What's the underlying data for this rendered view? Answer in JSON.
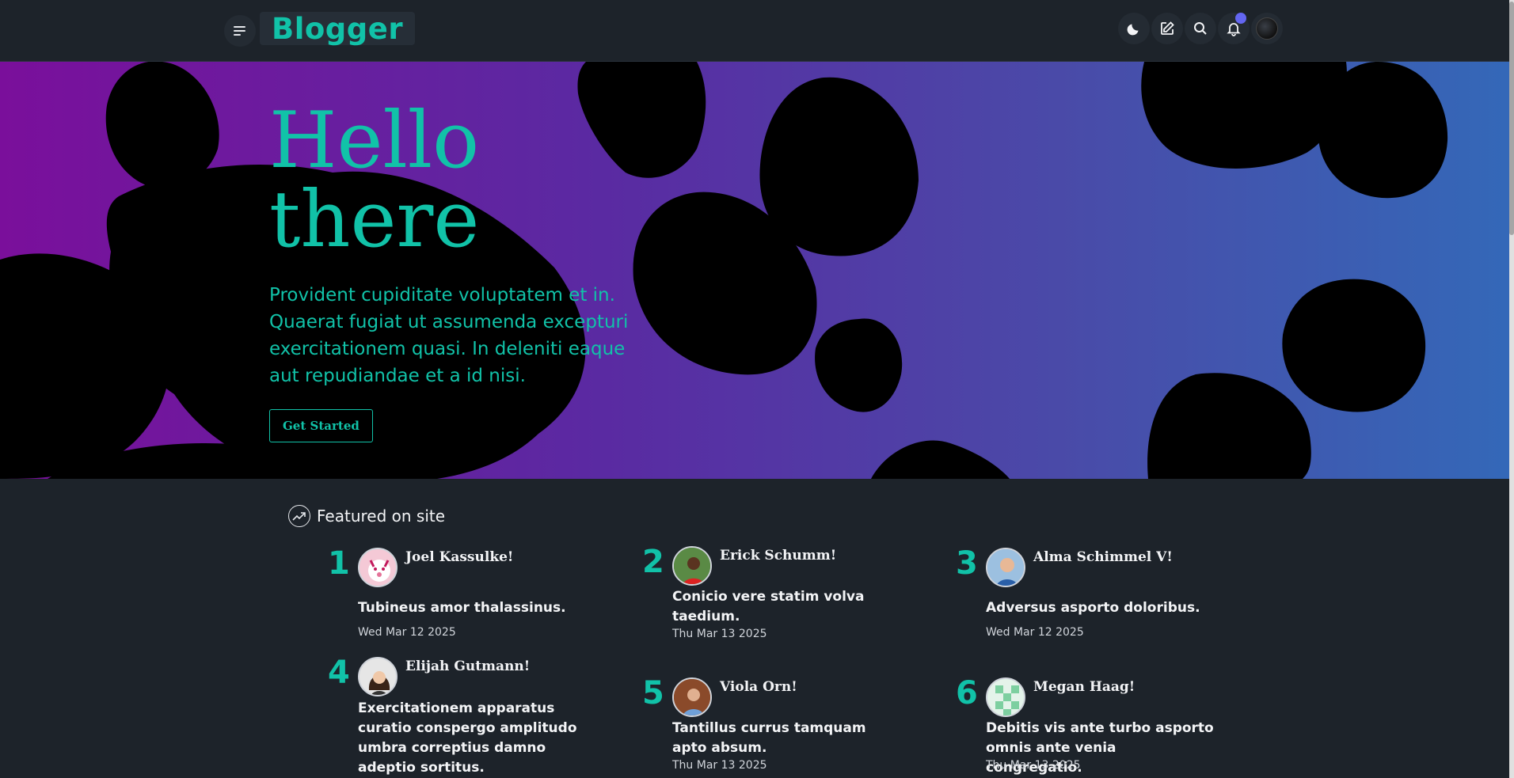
{
  "header": {
    "brand": "Blogger",
    "icons": [
      "menu-icon",
      "moon-icon",
      "edit-icon",
      "search-icon",
      "bell-icon",
      "avatar"
    ],
    "notification_color": "#6366f1"
  },
  "hero": {
    "title_line1": "Hello",
    "title_line2": "there",
    "text": "Provident cupiditate voluptatem et in. Quaerat fugiat ut assumenda excepturi exercitationem quasi. In deleniti eaque aut repudiandae et a id nisi.",
    "button": "Get Started",
    "accent": "#11c2a8"
  },
  "featured": {
    "heading": "Featured on site",
    "items": [
      {
        "rank": "1",
        "author": "Joel Kassulke!",
        "title": "Tubineus amor thalassinus.",
        "date": "Wed Mar 12 2025"
      },
      {
        "rank": "2",
        "author": "Erick Schumm!",
        "title": "Conicio vere statim volva taedium.",
        "date": "Thu Mar 13 2025"
      },
      {
        "rank": "3",
        "author": "Alma Schimmel V!",
        "title": "Adversus asporto doloribus.",
        "date": "Wed Mar 12 2025"
      },
      {
        "rank": "4",
        "author": "Elijah Gutmann!",
        "title": "Exercitationem apparatus curatio conspergo amplitudo umbra correptius damno adeptio sortitus.",
        "date": ""
      },
      {
        "rank": "5",
        "author": "Viola Orn!",
        "title": "Tantillus currus tamquam apto absum.",
        "date": "Thu Mar 13 2025"
      },
      {
        "rank": "6",
        "author": "Megan Haag!",
        "title": "Debitis vis ante turbo asporto omnis ante venia congregatio.",
        "date": "Thu Mar 13 2025"
      }
    ]
  }
}
